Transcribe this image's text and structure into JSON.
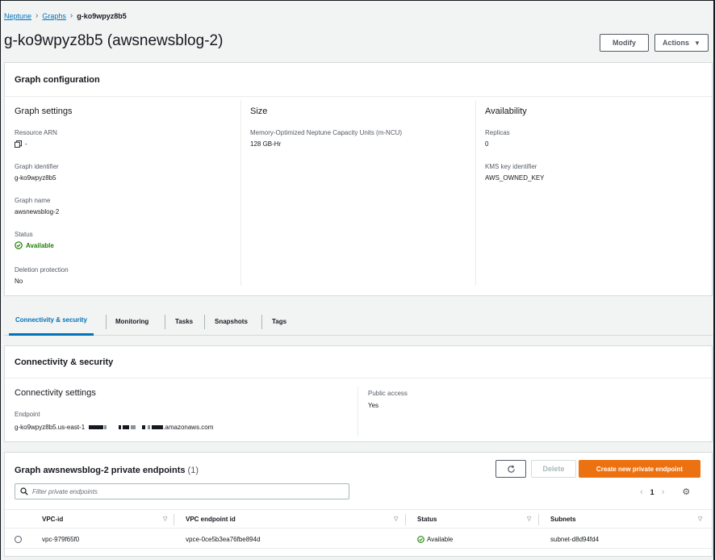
{
  "breadcrumb": {
    "items": [
      "Neptune",
      "Graphs"
    ],
    "current": "g-ko9wpyz8b5"
  },
  "page": {
    "title": "g-ko9wpyz8b5 (awsnewsblog-2)",
    "modify_label": "Modify",
    "actions_label": "Actions"
  },
  "graph_config": {
    "title": "Graph configuration",
    "settings": {
      "heading": "Graph settings",
      "resource_arn_label": "Resource ARN",
      "resource_arn_value": "-",
      "graph_identifier_label": "Graph identifier",
      "graph_identifier_value": "g-ko9wpyz8b5",
      "graph_name_label": "Graph name",
      "graph_name_value": "awsnewsblog-2",
      "status_label": "Status",
      "status_value": "Available",
      "deletion_label": "Deletion protection",
      "deletion_value": "No"
    },
    "size": {
      "heading": "Size",
      "mncu_label": "Memory-Optimized Neptune Capacity Units (m-NCU)",
      "mncu_value": "128 GB-Hr"
    },
    "availability": {
      "heading": "Availability",
      "replicas_label": "Replicas",
      "replicas_value": "0",
      "kms_label": "KMS key identifier",
      "kms_value": "AWS_OWNED_KEY"
    }
  },
  "tabs": [
    {
      "label": "Connectivity & security",
      "active": true
    },
    {
      "label": "Monitoring",
      "active": false
    },
    {
      "label": "Tasks",
      "active": false
    },
    {
      "label": "Snapshots",
      "active": false
    },
    {
      "label": "Tags",
      "active": false
    }
  ],
  "connectivity": {
    "title": "Connectivity & security",
    "settings_heading": "Connectivity settings",
    "endpoint_label": "Endpoint",
    "endpoint_prefix": "g-ko9wpyz8b5.us-east-1",
    "endpoint_suffix": ".amazonaws.com",
    "public_access_label": "Public access",
    "public_access_value": "Yes"
  },
  "endpoints": {
    "title": "Graph awsnewsblog-2 private endpoints",
    "count": "(1)",
    "delete_label": "Delete",
    "create_label": "Create new private endpoint",
    "filter_placeholder": "Filter private endpoints",
    "page": "1",
    "columns": [
      "VPC-id",
      "VPC endpoint id",
      "Status",
      "Subnets"
    ],
    "rows": [
      {
        "vpc_id": "vpc-979f65f0",
        "vpc_endpoint_id": "vpce-0ce5b3ea76fbe894d",
        "status": "Available",
        "subnets": "subnet-d8d94fd4"
      }
    ]
  },
  "colors": {
    "link": "#0073bb",
    "available": "#1d8102",
    "primary_button": "#ec7211"
  }
}
